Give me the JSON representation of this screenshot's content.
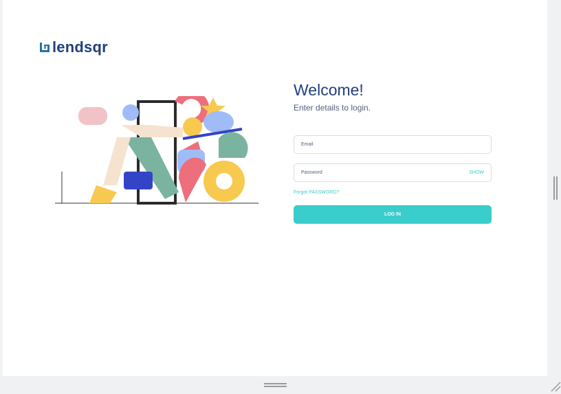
{
  "brand": {
    "name": "lendsqr",
    "color": "#213f7d",
    "accent": "#39cdcc"
  },
  "login": {
    "title": "Welcome!",
    "subtitle": "Enter details to login.",
    "email_placeholder": "Email",
    "password_placeholder": "Password",
    "show_label": "SHOW",
    "forgot_label": "Forgot PASSWORD?",
    "login_label": "LOG IN"
  }
}
